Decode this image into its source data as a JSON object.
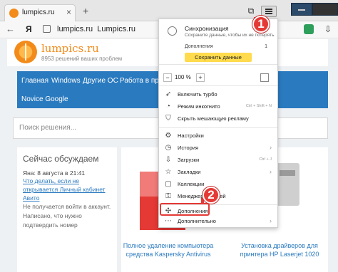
{
  "browser": {
    "tab_title": "lumpics.ru",
    "new_tab": "+",
    "ya_label": "Я",
    "url_domain": "lumpics.ru",
    "url_title": "Lumpics.ru",
    "icons": {
      "back": "arrow-left-icon",
      "bookmark": "bookmark-icon",
      "menu": "hamburger-menu-icon"
    }
  },
  "site": {
    "name": "lumpics.ru",
    "tagline": "8953 решений ваших проблем",
    "nav": [
      "Главная",
      "Windows",
      "Другие ОС",
      "Работа в прог",
      "Novice Google"
    ],
    "search_placeholder": "Поиск решения...",
    "comments": {
      "title": "Сейчас обсуждаем",
      "author": "Яна: 8 августа в 21:41",
      "link": "Что делать, если не открывается Личный кабинет Авито",
      "text": "Не получается войти в аккаунт. Написано, что нужно подтвердить номер"
    },
    "promo": {
      "left_link": "Полное удаление компьютера средства Kaspersky Antivirus",
      "right_link": "Установка драйверов для принтера HP Laserjet 1020"
    }
  },
  "menu": {
    "sync_title": "Синхронизация",
    "sync_desc": "Сохраните данные, чтобы их не потерять",
    "sync_addons": "Дополнения",
    "sync_count": "1",
    "save_button": "Сохранить данные",
    "zoom_minus": "−",
    "zoom_value": "100 %",
    "zoom_plus": "+",
    "items": [
      {
        "label": "Включить турбо",
        "icon": "rocket-icon",
        "shortcut": "",
        "arrow": false
      },
      {
        "label": "Режим инкогнито",
        "icon": "incognito-icon",
        "shortcut": "Ctrl + Shift + N",
        "arrow": false
      },
      {
        "label": "Скрыть мешающую рекламу",
        "icon": "shield-icon",
        "shortcut": "",
        "arrow": false
      },
      {
        "label": "Настройки",
        "icon": "gear-icon",
        "shortcut": "",
        "arrow": false
      },
      {
        "label": "История",
        "icon": "history-icon",
        "shortcut": "",
        "arrow": true
      },
      {
        "label": "Загрузки",
        "icon": "download-icon",
        "shortcut": "Ctrl + J",
        "arrow": false
      },
      {
        "label": "Закладки",
        "icon": "star-icon",
        "shortcut": "",
        "arrow": true
      },
      {
        "label": "Коллекции",
        "icon": "collections-icon",
        "shortcut": "",
        "arrow": false
      },
      {
        "label": "Менеджер паролей",
        "icon": "key-icon",
        "shortcut": "",
        "arrow": false
      },
      {
        "label": "Дополнения",
        "icon": "puzzle-icon",
        "shortcut": "",
        "arrow": false
      },
      {
        "label": "Дополнительно",
        "icon": "more-icon",
        "shortcut": "",
        "arrow": true
      }
    ]
  },
  "callouts": {
    "one": "1",
    "two": "2"
  },
  "colors": {
    "accent": "#e53935",
    "brand": "#f28b1a",
    "nav": "#2a7abf",
    "yellow": "#ffdb4d"
  }
}
